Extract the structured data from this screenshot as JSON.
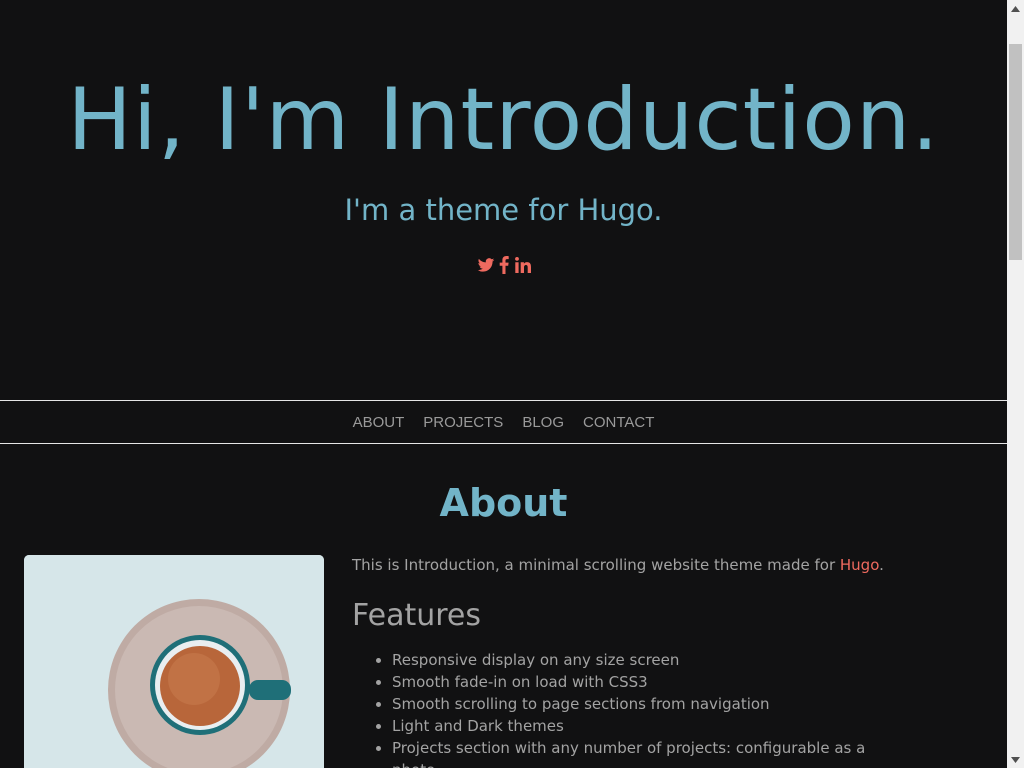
{
  "hero": {
    "title": "Hi, I'm Introduction.",
    "subtitle": "I'm a theme for Hugo.",
    "social": [
      {
        "icon": "twitter-icon"
      },
      {
        "icon": "facebook-icon"
      },
      {
        "icon": "linkedin-icon"
      }
    ]
  },
  "nav": {
    "items": [
      {
        "label": "ABOUT"
      },
      {
        "label": "PROJECTS"
      },
      {
        "label": "BLOG"
      },
      {
        "label": "CONTACT"
      }
    ]
  },
  "about": {
    "heading": "About",
    "intro_prefix": "This is Introduction, a minimal scrolling website theme made for ",
    "intro_link": "Hugo",
    "intro_suffix": ".",
    "features_heading": "Features",
    "features": [
      "Responsive display on any size screen",
      "Smooth fade-in on load with CSS3",
      "Smooth scrolling to page sections from navigation",
      "Light and Dark themes",
      "Projects section with any number of projects: configurable as a photo"
    ]
  },
  "colors": {
    "background": "#111112",
    "heading_blue": "#72b4c8",
    "accent": "#ef6a5f",
    "body_text": "#a3a3a3",
    "nav_text": "#9a9a9a"
  }
}
